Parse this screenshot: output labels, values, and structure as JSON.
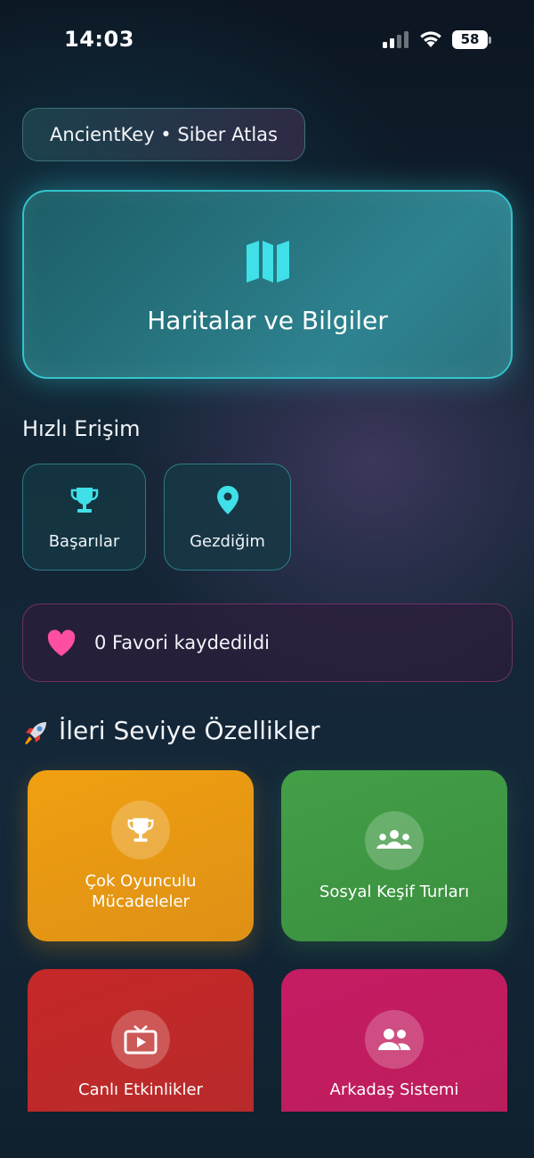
{
  "status_bar": {
    "time": "14:03",
    "battery": "58",
    "icons": [
      "signal-icon",
      "wifi-icon",
      "battery-icon"
    ]
  },
  "app_chip": {
    "label": "AncientKey • Siber Atlas"
  },
  "hero": {
    "title": "Haritalar ve Bilgiler",
    "icon": "map-icon"
  },
  "quick_access": {
    "title": "Hızlı Erişim",
    "items": [
      {
        "label": "Başarılar",
        "icon": "trophy-icon"
      },
      {
        "label": "Gezdiğim",
        "icon": "location-pin-icon"
      }
    ]
  },
  "favorites": {
    "text": "0 Favori kaydedildi",
    "icon": "heart-icon"
  },
  "advanced": {
    "title": "İleri Seviye Özellikler",
    "icon": "rocket-icon",
    "cards": [
      {
        "label_lines": [
          "Çok Oyunculu",
          "Mücadeleler"
        ],
        "icon": "trophy-icon"
      },
      {
        "label": "Sosyal Keşif Turları",
        "icon": "groups-icon"
      },
      {
        "label": "Canlı Etkinlikler",
        "icon": "live-tv-icon"
      },
      {
        "label": "Arkadaş Sistemi",
        "icon": "friends-icon"
      }
    ]
  },
  "colors": {
    "accent_cyan": "#33c4cc",
    "heart_pink": "#ff4fa3",
    "card_orange": "#f0a010",
    "card_green": "#43a047",
    "card_red": "#c62828",
    "card_pink": "#c71c63"
  }
}
